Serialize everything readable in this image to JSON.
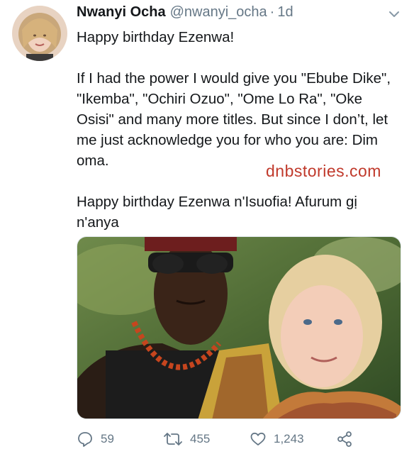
{
  "tweet": {
    "author_name": "Nwanyi Ocha",
    "author_handle": "@nwanyi_ocha",
    "separator": "·",
    "time": "1d",
    "text_line1": "Happy birthday Ezenwa!",
    "text_para2": "If I had the power I would give you \"Ebube Dike\", \"Ikemba\", \"Ochiri Ozuo\", \"Ome Lo Ra\", \"Oke Osisi\" and many more titles. But since I don’t, let me just acknowledge you for who you are: Dim oma.",
    "text_para3": "Happy birthday Ezenwa n'Isuofia! Afurum gị n'anya",
    "watermark": "dnbstories.com"
  },
  "actions": {
    "reply_count": "59",
    "retweet_count": "455",
    "like_count": "1,243"
  },
  "icons": {
    "more": "chevron-down-icon",
    "reply": "reply-icon",
    "retweet": "retweet-icon",
    "like": "heart-icon",
    "share": "share-icon"
  },
  "colors": {
    "text": "#14171a",
    "muted": "#657786",
    "watermark": "#c0392b"
  }
}
